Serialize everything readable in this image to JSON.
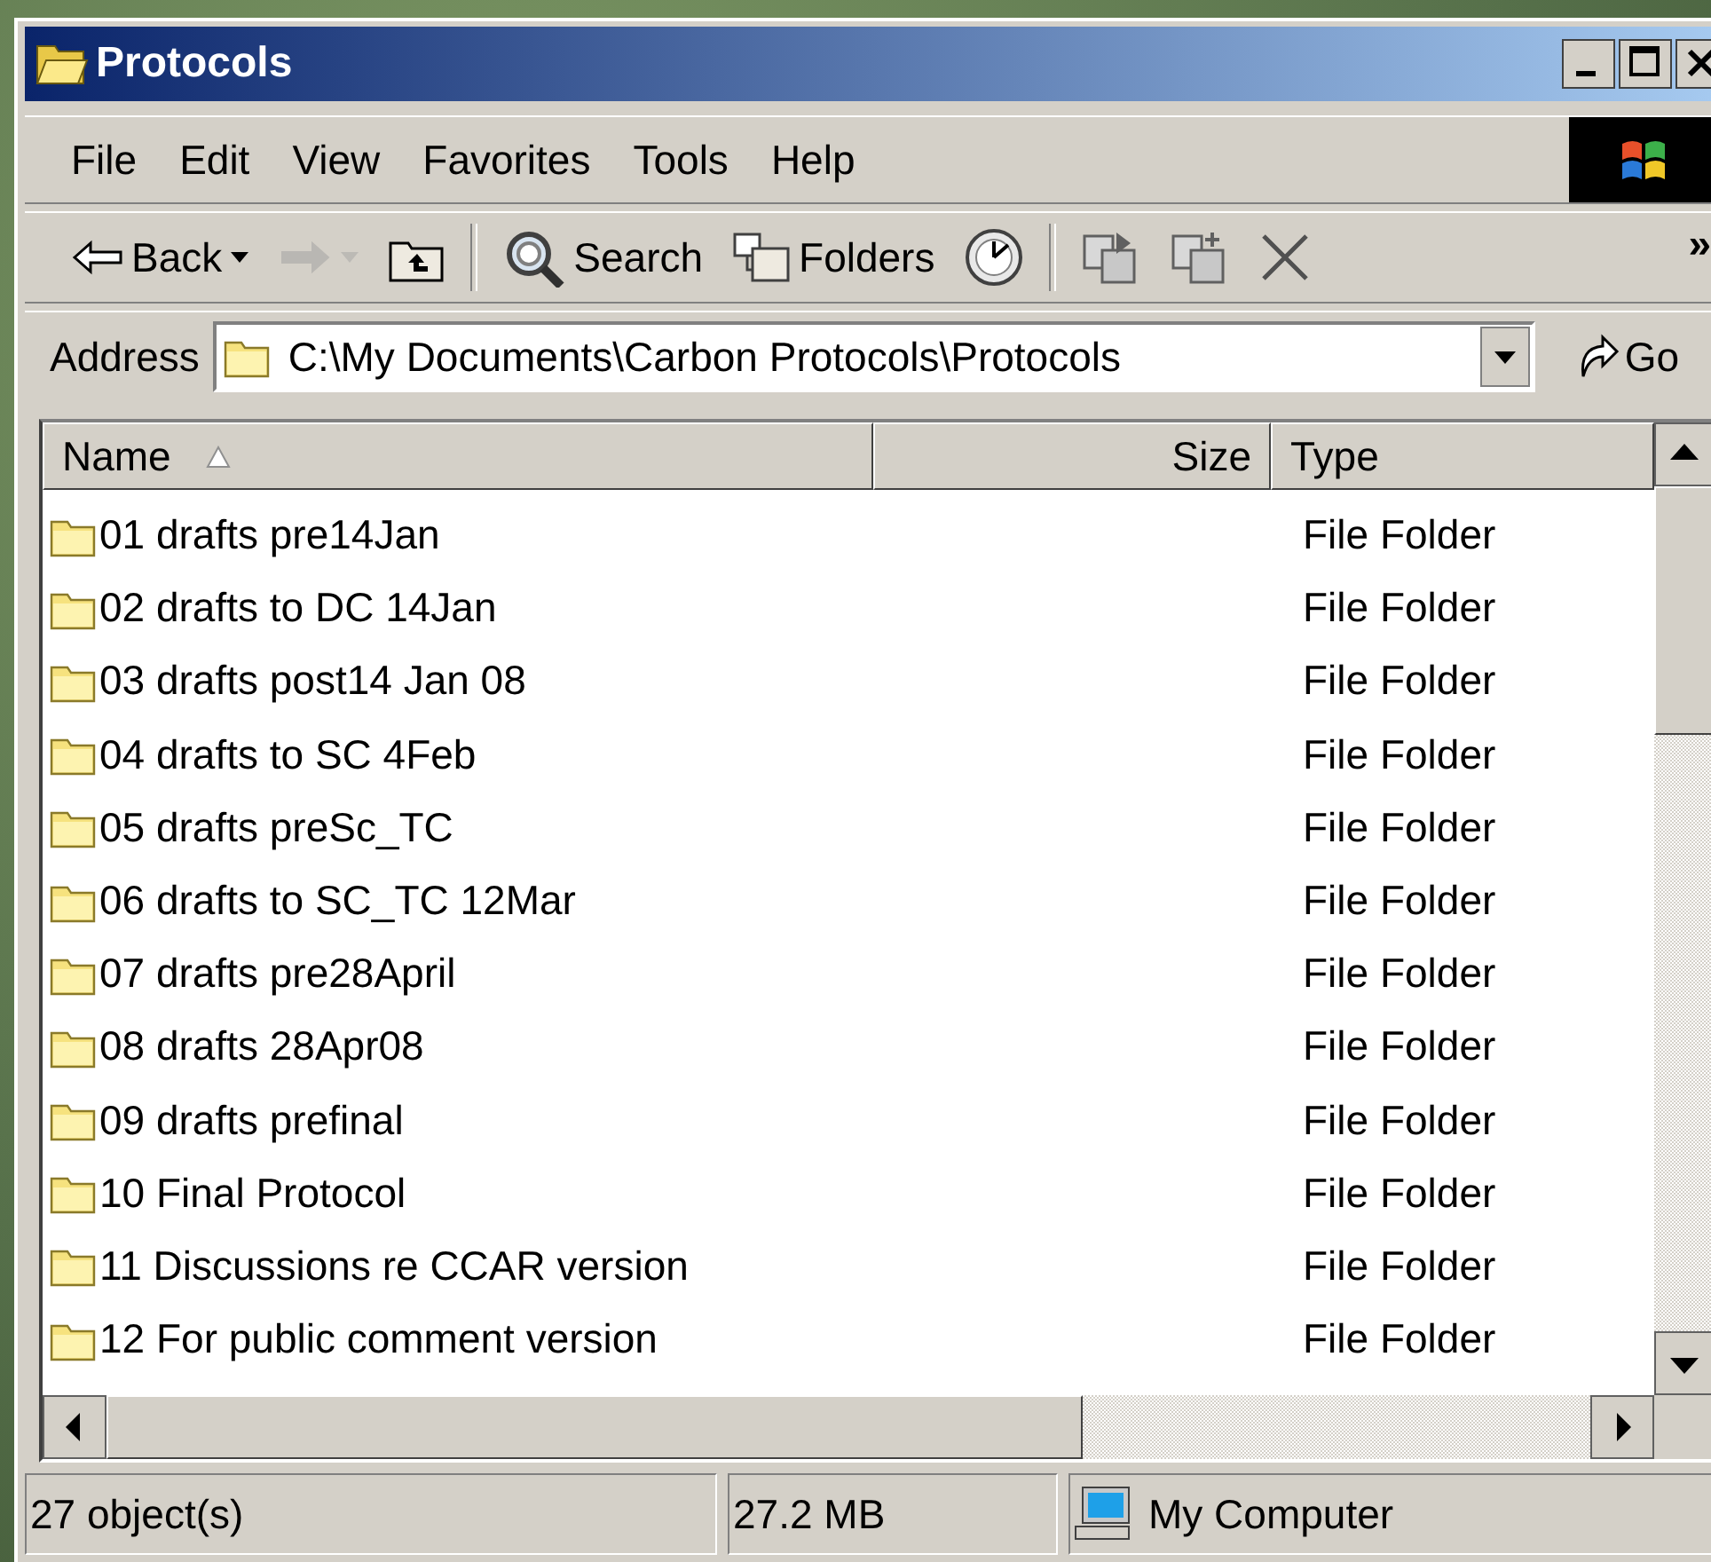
{
  "window": {
    "title": "Protocols"
  },
  "menu": [
    {
      "label": "File"
    },
    {
      "label": "Edit"
    },
    {
      "label": "View"
    },
    {
      "label": "Favorites"
    },
    {
      "label": "Tools"
    },
    {
      "label": "Help"
    }
  ],
  "toolbar": [
    {
      "kind": "back",
      "label": "Back",
      "disabled": false
    },
    {
      "kind": "forward",
      "disabled": true
    },
    {
      "kind": "up",
      "disabled": false
    },
    {
      "kind": "separator"
    },
    {
      "kind": "search",
      "label": "Search",
      "disabled": false
    },
    {
      "kind": "folders",
      "label": "Folders",
      "disabled": false
    },
    {
      "kind": "history",
      "disabled": false
    },
    {
      "kind": "separator"
    },
    {
      "kind": "move",
      "disabled": false
    },
    {
      "kind": "copy",
      "disabled": false
    },
    {
      "kind": "delete",
      "disabled": false
    }
  ],
  "toolbar_overflow": "»",
  "address": {
    "label": "Address",
    "value": "C:\\My Documents\\Carbon Protocols\\Protocols",
    "go": "Go"
  },
  "table": {
    "columns": [
      {
        "label": "Name",
        "sorted": true
      },
      {
        "label": "Size",
        "sorted": false
      },
      {
        "label": "Type",
        "sorted": false
      }
    ],
    "rows": [
      {
        "name": "01 drafts pre14Jan",
        "type": "File Folder"
      },
      {
        "name": "02 drafts to DC 14Jan",
        "type": "File Folder"
      },
      {
        "name": "03 drafts post14 Jan 08",
        "type": "File Folder"
      },
      {
        "name": "04 drafts to SC 4Feb",
        "type": "File Folder"
      },
      {
        "name": "05 drafts preSc_TC",
        "type": "File Folder"
      },
      {
        "name": "06 drafts to SC_TC 12Mar",
        "type": "File Folder"
      },
      {
        "name": "07 drafts pre28April",
        "type": "File Folder"
      },
      {
        "name": "08 drafts 28Apr08",
        "type": "File Folder"
      },
      {
        "name": "09 drafts prefinal",
        "type": "File Folder"
      },
      {
        "name": "10 Final Protocol",
        "type": "File Folder"
      },
      {
        "name": "11 Discussions re CCAR version",
        "type": "File Folder"
      },
      {
        "name": "12 For public comment version",
        "type": "File Folder"
      }
    ]
  },
  "status_bar": {
    "objects": "27 object(s)",
    "size": "27.2 MB",
    "zone": "My Computer"
  }
}
